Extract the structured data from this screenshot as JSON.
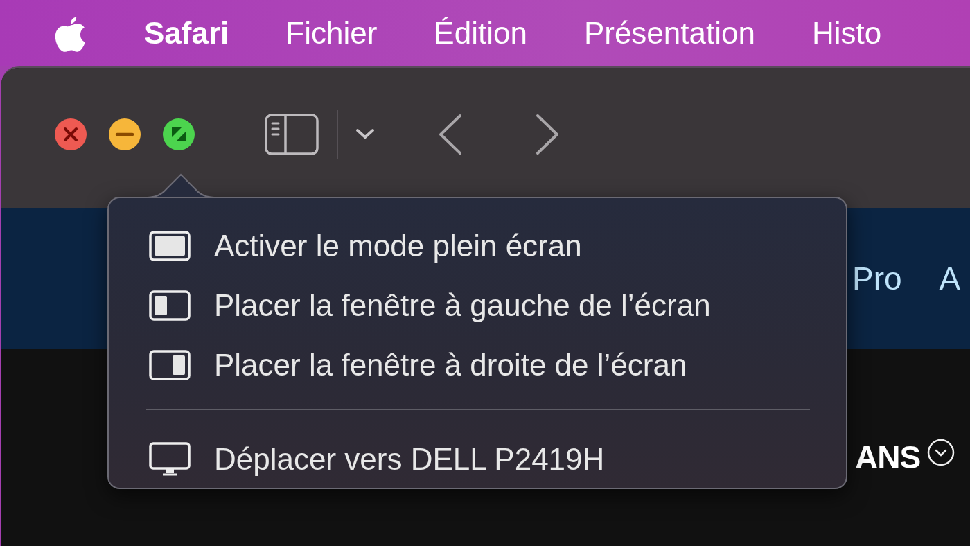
{
  "menu_bar": {
    "app": "Safari",
    "items": [
      "Fichier",
      "Édition",
      "Présentation",
      "Histo"
    ]
  },
  "page": {
    "nav_items": [
      "Pro",
      "A"
    ],
    "heading": "ANS"
  },
  "popover": {
    "sections": [
      [
        {
          "kind": "fullscreen",
          "label": "Activer le mode plein écran"
        },
        {
          "kind": "left",
          "label": "Placer la fenêtre à gauche de l’écran"
        },
        {
          "kind": "right",
          "label": "Placer la fenêtre à droite de l’écran"
        }
      ],
      [
        {
          "kind": "display",
          "label": "Déplacer vers DELL P2419H"
        }
      ]
    ]
  }
}
